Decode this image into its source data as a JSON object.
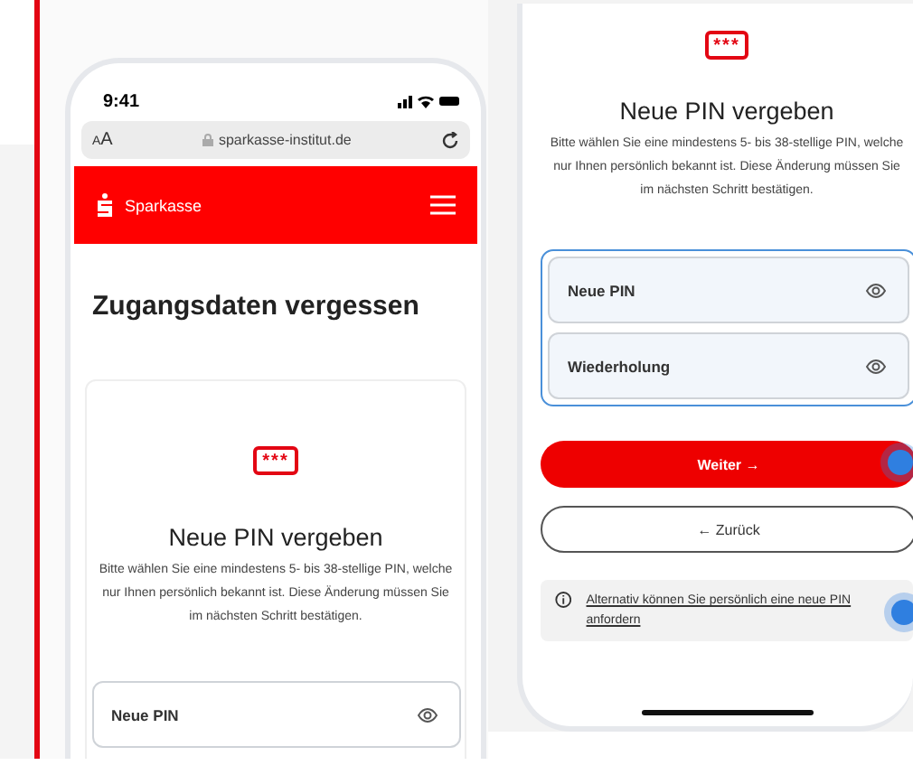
{
  "left_phone": {
    "status_bar": {
      "time": "9:41"
    },
    "browser_bar": {
      "text_size": "AA",
      "url": "sparkasse-institut.de"
    },
    "header": {
      "brand": "Sparkasse"
    },
    "page_title": "Zugangsdaten vergessen",
    "card": {
      "badge": "***",
      "heading": "Neue PIN vergeben",
      "text": "Bitte wählen Sie eine mindestens 5- bis 38-stellige PIN, welche nur Ihnen persönlich bekannt ist. Diese Änderung müssen Sie im nächsten Schritt bestätigen.",
      "fields": [
        {
          "label": "Neue PIN"
        }
      ]
    }
  },
  "right_phone": {
    "badge": "***",
    "heading": "Neue PIN vergeben",
    "text": "Bitte wählen Sie eine mindestens 5- bis 38-stellige PIN, welche nur Ihnen persönlich bekannt ist. Diese Änderung müssen Sie im nächsten Schritt bestätigen.",
    "field_group": {
      "focused": true,
      "fields": [
        {
          "label": "Neue PIN"
        },
        {
          "label": "Wiederholung"
        }
      ]
    },
    "buttons": [
      {
        "label": "Weiter →",
        "kind": "primary"
      },
      {
        "label": "← Zurück",
        "kind": "secondary"
      }
    ],
    "info": {
      "link": "Alternativ können Sie persönlich eine neue PIN anfordern"
    }
  }
}
